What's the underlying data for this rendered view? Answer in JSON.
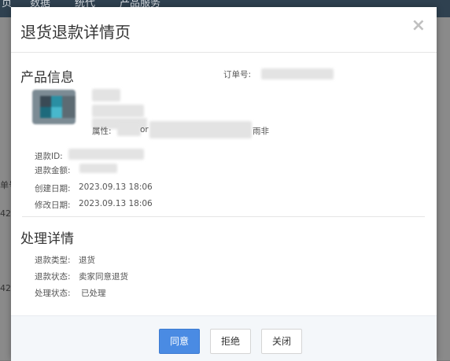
{
  "background": {
    "nav_items": [
      "页",
      "数据",
      "统代",
      "产品服务"
    ],
    "side_texts": [
      "单号",
      "42",
      "42"
    ]
  },
  "modal": {
    "title": "退货退款详情页",
    "close_glyph": "×",
    "product_section": {
      "title": "产品信息",
      "order_no_label": "订单号:",
      "attribute_label": "属性:",
      "attribute_value_tail": "or",
      "attribute_value_end": "雨非"
    },
    "refund": {
      "id_label": "退款ID:",
      "amount_label": "退款金额:",
      "created_label": "创建日期:",
      "created_value": "2023.09.13 18:06",
      "modified_label": "修改日期:",
      "modified_value": "2023.09.13 18:06"
    },
    "process_section": {
      "title": "处理详情",
      "refund_type_label": "退款类型:",
      "refund_type_value": "退货",
      "refund_status_label": "退款状态:",
      "refund_status_value": "卖家同意退货",
      "process_status_label": "处理状态:",
      "process_status_value": "已处理"
    },
    "footer": {
      "agree_label": "同意",
      "reject_label": "拒绝",
      "close_label": "关闭"
    }
  }
}
